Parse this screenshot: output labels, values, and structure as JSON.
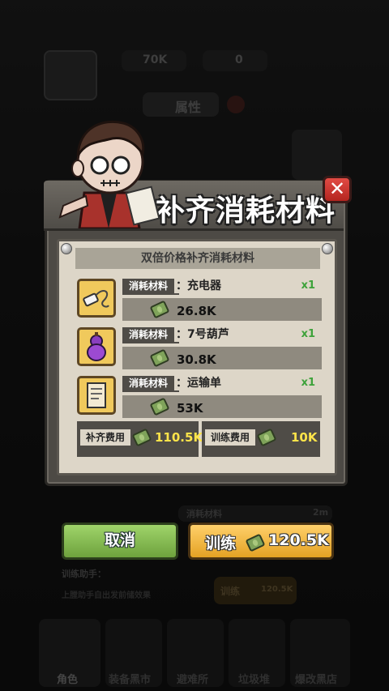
{
  "hud": {
    "cash": "70K",
    "gems": "0",
    "attributes_label": "属性",
    "bg_material_label": "消耗材料",
    "bg_time": "2m",
    "bg_helper_label": "训练助手：",
    "bg_hint": "上膛助手自出发前储效果",
    "bg_train_label": "训练",
    "bg_train_cost": "120.5K"
  },
  "bottom_nav": [
    {
      "label": "角色"
    },
    {
      "label": "装备黑市"
    },
    {
      "label": "避难所"
    },
    {
      "label": "垃圾堆"
    },
    {
      "label": "爆改黑店"
    }
  ],
  "dialog": {
    "title": "补齐消耗材料",
    "header": "双倍价格补齐消耗材料",
    "items": [
      {
        "tag": "消耗材料",
        "name": "：充电器",
        "qty": "x1",
        "price": "26.8K",
        "icon": "charger-icon"
      },
      {
        "tag": "消耗材料",
        "name": "：7号葫芦",
        "qty": "x1",
        "price": "30.8K",
        "icon": "gourd-icon"
      },
      {
        "tag": "消耗材料",
        "name": "：运输单",
        "qty": "x1",
        "price": "53K",
        "icon": "document-icon"
      }
    ],
    "refill_cost_label": "补齐费用",
    "refill_cost": "110.5K",
    "train_cost_label": "训练费用",
    "train_cost": "10K"
  },
  "buttons": {
    "cancel": "取消",
    "train_label": "训练",
    "train_total": "120.5K"
  },
  "colors": {
    "cancel_green": "#8cc455",
    "train_orange": "#f5b53e",
    "close_red": "#d2382f",
    "cost_yellow": "#ffe44a",
    "qty_green": "#3da23a"
  }
}
